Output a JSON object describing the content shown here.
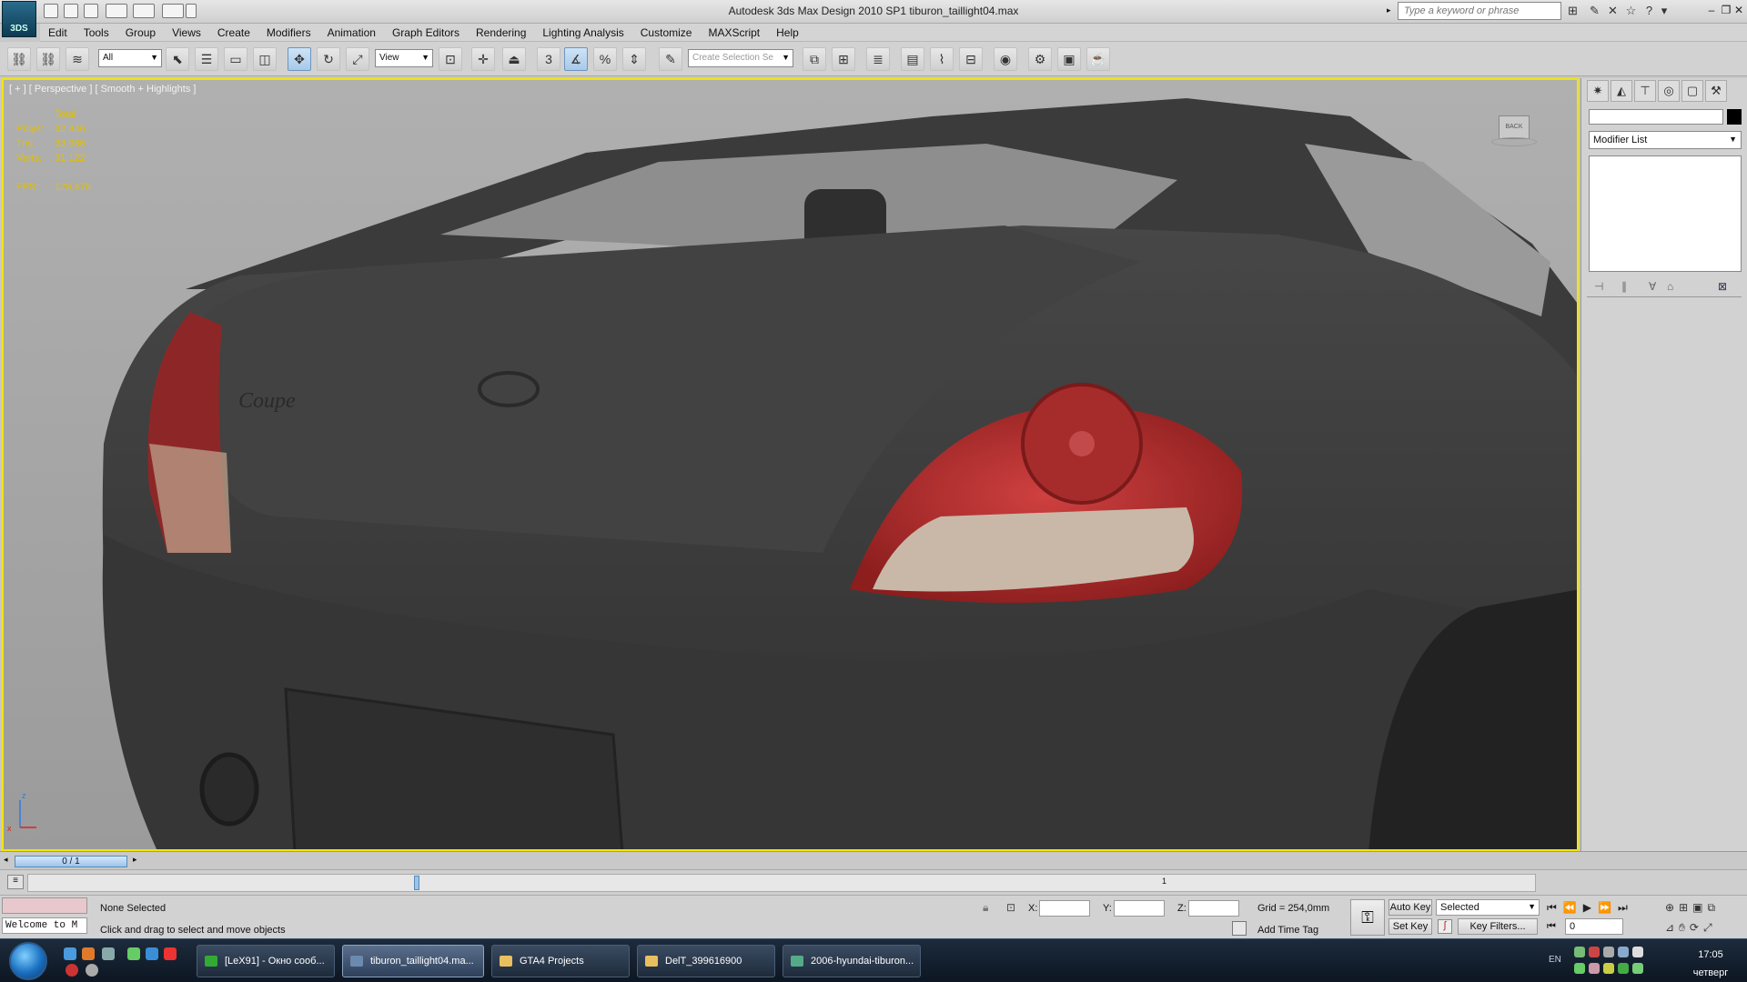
{
  "app": {
    "logo_text": "3DS",
    "title": "Autodesk 3ds Max Design 2010 SP1      tiburon_taillight04.max"
  },
  "search": {
    "placeholder": "Type a keyword or phrase"
  },
  "menu": [
    "Edit",
    "Tools",
    "Group",
    "Views",
    "Create",
    "Modifiers",
    "Animation",
    "Graph Editors",
    "Rendering",
    "Lighting Analysis",
    "Customize",
    "MAXScript",
    "Help"
  ],
  "toolbar": {
    "selection_filter": "All",
    "ref_coord": "View",
    "snap_label": "3",
    "named_selection_placeholder": "Create Selection Se"
  },
  "viewport": {
    "label": "[ + ] [ Perspective ] [ Smooth + Highlights ]",
    "stats": {
      "header": "Total",
      "polys_label": "Polys:",
      "polys": "32 846",
      "tris_label": "Tris:",
      "tris": "33 986",
      "verts_label": "Verts:",
      "verts": "31 122",
      "fps_label": "FPS:",
      "fps": "129,476"
    },
    "viewcube_label": "BACK",
    "badge_text": "Coupe",
    "axis": {
      "z": "z",
      "x": "x"
    }
  },
  "command_panel": {
    "modifier_list": "Modifier List"
  },
  "timeline": {
    "frame": "0 / 1",
    "tick": "1"
  },
  "status": {
    "selection": "None Selected",
    "prompt": "Click and drag to select and move objects",
    "maxscript": "Welcome to M",
    "x_label": "X:",
    "y_label": "Y:",
    "z_label": "Z:",
    "grid": "Grid = 254,0mm",
    "add_time_tag": "Add Time Tag",
    "auto_key": "Auto Key",
    "set_key": "Set Key",
    "key_mode": "Selected",
    "key_filters": "Key Filters...",
    "frame_field": "0"
  },
  "taskbar": {
    "tasks": [
      "[LeX91] - Окно сооб...",
      "tiburon_taillight04.ma...",
      "GTA4 Projects",
      "DelT_399616900",
      "2006-hyundai-tiburon..."
    ],
    "lang": "EN",
    "time": "17:05",
    "day": "четверг"
  },
  "colors": {
    "viewport_border": "#f2e600",
    "stats_text": "#e0c000",
    "taillight_red": "#b52a2a"
  }
}
